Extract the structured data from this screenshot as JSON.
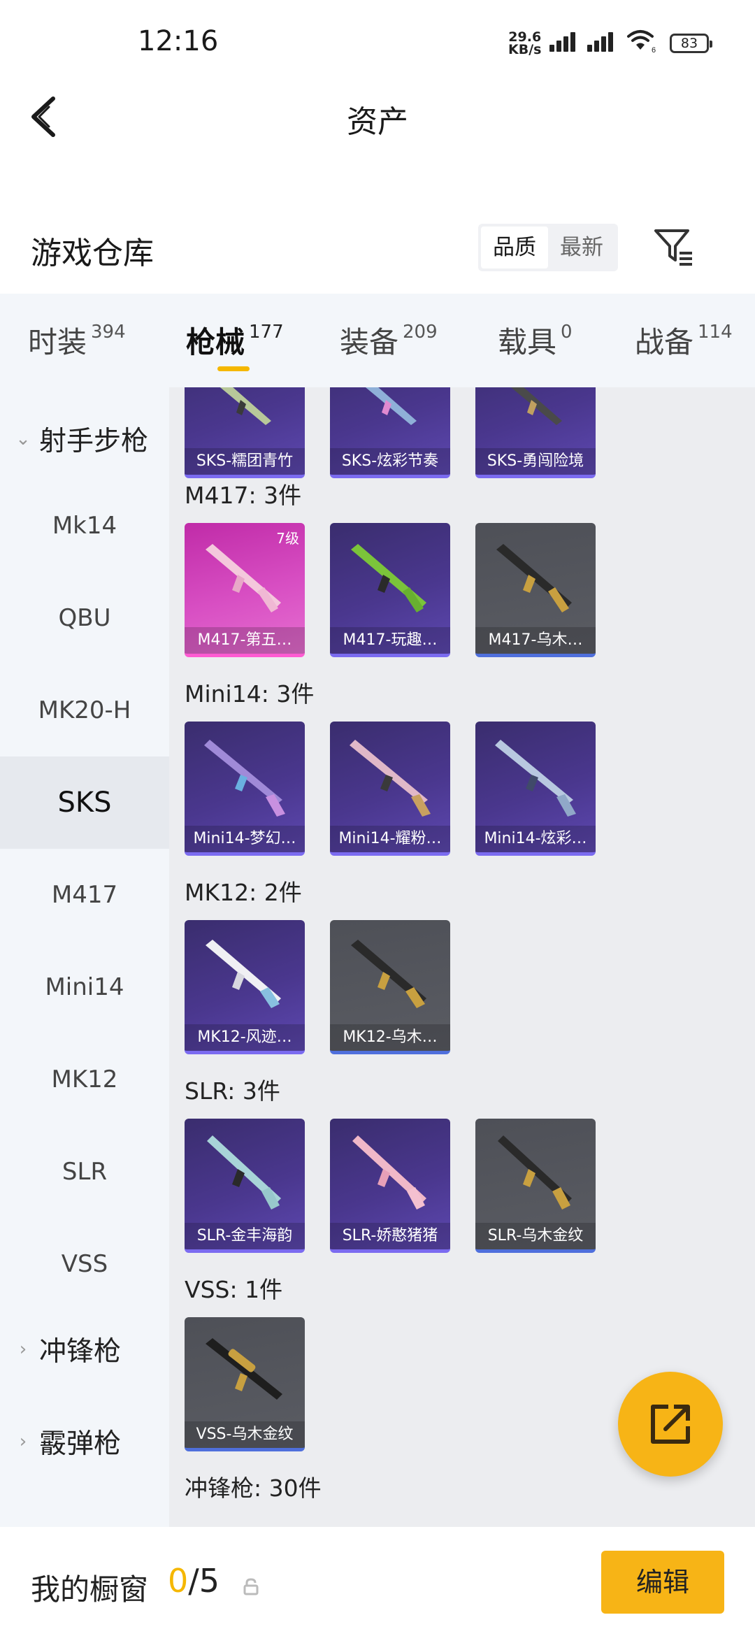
{
  "status": {
    "time": "12:16",
    "net_speed_value": "29.6",
    "net_speed_unit": "KB/s",
    "wifi_badge": "6",
    "battery": "83"
  },
  "nav": {
    "title": "资产"
  },
  "warehouse": {
    "title": "游戏仓库",
    "sort_options": [
      "品质",
      "最新"
    ],
    "sort_selected": "品质"
  },
  "tabs": [
    {
      "label": "时装",
      "count": "394"
    },
    {
      "label": "枪械",
      "count": "177",
      "active": true
    },
    {
      "label": "装备",
      "count": "209"
    },
    {
      "label": "载具",
      "count": "0"
    },
    {
      "label": "战备",
      "count": "114"
    }
  ],
  "sidebar": {
    "group_open": "射手步枪",
    "items": [
      "Mk14",
      "QBU",
      "MK20-H",
      "SKS",
      "M417",
      "Mini14",
      "MK12",
      "SLR",
      "VSS"
    ],
    "selected": "SKS",
    "groups_closed": [
      "冲锋枪",
      "霰弹枪"
    ]
  },
  "content": {
    "sks_partial": [
      "SKS-糯团青竹",
      "SKS-炫彩节奏",
      "SKS-勇闯险境"
    ],
    "sections": [
      {
        "title": "M417: 3件",
        "items": [
          {
            "name": "M417-第五…",
            "level": "7级",
            "color": "pink"
          },
          {
            "name": "M417-玩趣…",
            "color": "purple"
          },
          {
            "name": "M417-乌木…",
            "color": "gray"
          }
        ]
      },
      {
        "title": "Mini14: 3件",
        "items": [
          {
            "name": "Mini14-梦幻…",
            "color": "purple"
          },
          {
            "name": "Mini14-耀粉…",
            "color": "purple"
          },
          {
            "name": "Mini14-炫彩…",
            "color": "purple"
          }
        ]
      },
      {
        "title": "MK12: 2件",
        "items": [
          {
            "name": "MK12-风迹…",
            "color": "purple"
          },
          {
            "name": "MK12-乌木…",
            "color": "gray"
          }
        ]
      },
      {
        "title": "SLR: 3件",
        "items": [
          {
            "name": "SLR-金丰海韵",
            "color": "purple"
          },
          {
            "name": "SLR-娇憨猪猪",
            "color": "purple"
          },
          {
            "name": "SLR-乌木金纹",
            "color": "gray"
          }
        ]
      },
      {
        "title": "VSS: 1件",
        "items": [
          {
            "name": "VSS-乌木金纹",
            "color": "gray"
          }
        ]
      }
    ],
    "next_section": "冲锋枪: 30件"
  },
  "showcase": {
    "label": "我的橱窗",
    "used": "0",
    "sep": "/",
    "total": "5",
    "edit": "编辑"
  },
  "colors": {
    "accent": "#f5b700",
    "rarity_purple": "#4a378e",
    "rarity_pink": "#d84fc3",
    "rarity_gray": "#55575e"
  }
}
